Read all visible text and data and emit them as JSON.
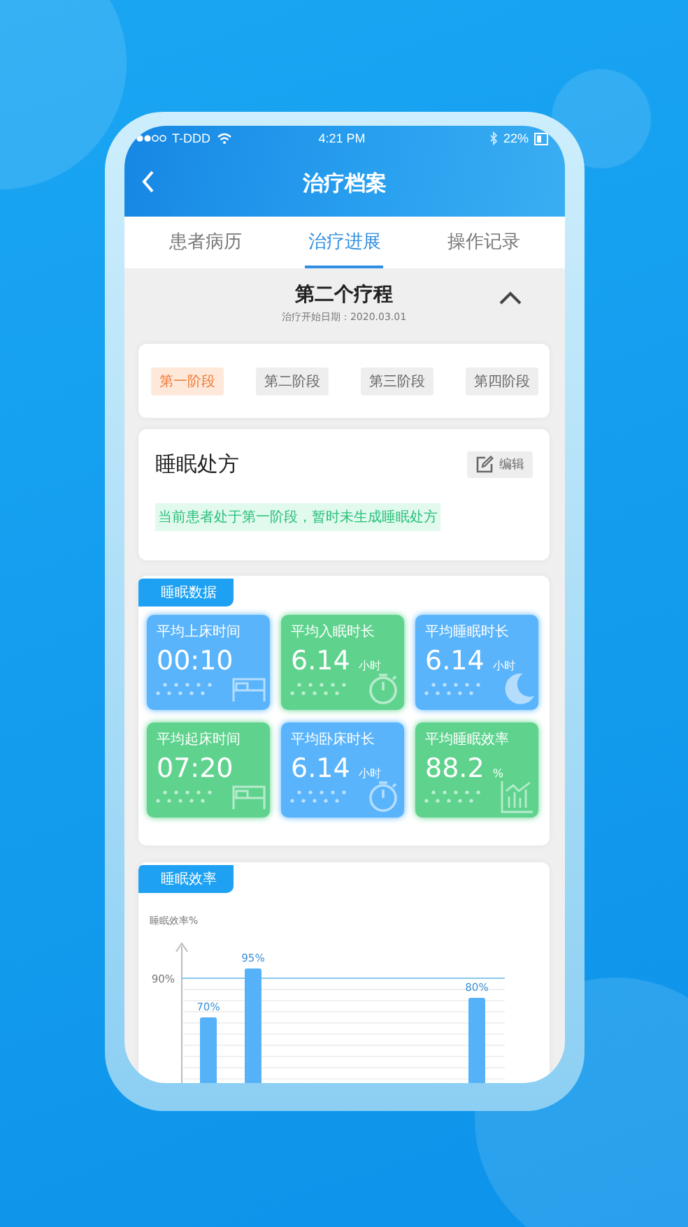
{
  "status_bar": {
    "carrier": "T-DDD",
    "time": "4:21 PM",
    "battery": "22%"
  },
  "header": {
    "title": "治疗档案"
  },
  "tabs": [
    {
      "label": "患者病历",
      "selected": false
    },
    {
      "label": "治疗进展",
      "selected": true
    },
    {
      "label": "操作记录",
      "selected": false
    }
  ],
  "course": {
    "title": "第二个疗程",
    "start_date": "治疗开始日期：2020.03.01",
    "expanded": true
  },
  "stages": [
    {
      "label": "第一阶段",
      "selected": true
    },
    {
      "label": "第二阶段",
      "selected": false
    },
    {
      "label": "第三阶段",
      "selected": false
    },
    {
      "label": "第四阶段",
      "selected": false
    }
  ],
  "prescription": {
    "title": "睡眠处方",
    "edit_label": "编辑",
    "notice": "当前患者处于第一阶段，暂时未生成睡眠处方"
  },
  "sleep_data": {
    "title": "睡眠数据",
    "cards": [
      {
        "label": "平均上床时间",
        "value": "00:10",
        "color": "#5ab4fb",
        "kind": "bed"
      },
      {
        "label": "平均入眠时长",
        "value": "6.14",
        "unit": "小时",
        "color": "#5fd38e",
        "kind": "stopwatch"
      },
      {
        "label": "平均睡眠时长",
        "value": "6.14",
        "unit": "小时",
        "color": "#5ab4fb",
        "kind": "moon"
      },
      {
        "label": "平均起床时间",
        "value": "07:20",
        "color": "#5fd38e",
        "kind": "bed"
      },
      {
        "label": "平均卧床时长",
        "value": "6.14",
        "unit": "小时",
        "color": "#5ab4fb",
        "kind": "stopwatch"
      },
      {
        "label": "平均睡眠效率",
        "value": "88.2",
        "unit": "%",
        "color": "#5fd38e",
        "kind": "chart"
      }
    ]
  },
  "efficiency": {
    "title": "睡眠效率",
    "axis_title": "睡眠效率%",
    "reference_label": "90%",
    "bar_labels": [
      "70%",
      "95%",
      "80%"
    ]
  }
}
